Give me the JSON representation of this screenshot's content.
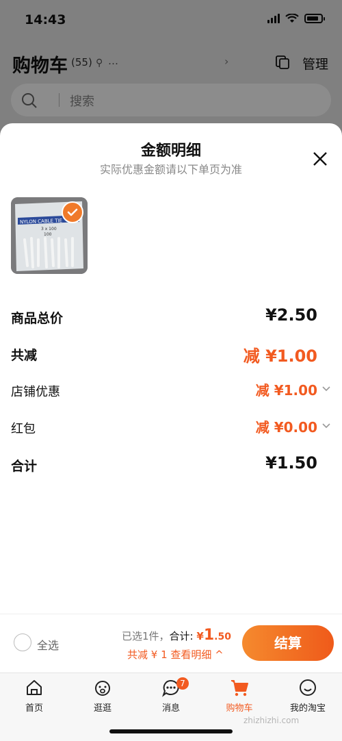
{
  "status_bar": {
    "time": "14:43"
  },
  "header": {
    "title": "购物车",
    "count": "(55)",
    "location": "…",
    "manage_label": "管理"
  },
  "search": {
    "placeholder": "搜索"
  },
  "sheet": {
    "title": "金额明细",
    "subtitle": "实际优惠金额请以下单页为准",
    "product_image_text": [
      "NYLON CABLE TIE",
      "3 x 100",
      "100"
    ],
    "rows": [
      {
        "label": "商品总价",
        "value": "¥2.50"
      },
      {
        "label": "共减",
        "value": "减 ¥1.00"
      },
      {
        "label": "店铺优惠",
        "value": "减 ¥1.00"
      },
      {
        "label": "红包",
        "value": "减 ¥0.00"
      },
      {
        "label": "合计",
        "value": "¥1.50"
      }
    ]
  },
  "bottom_bar": {
    "select_all": "全选",
    "selected_text": "已选1件，",
    "total_label": "合计:",
    "total_yen": "¥",
    "total_int": "1",
    "total_cents": ".50",
    "discount_text": "共减 ¥ 1  查看明细 ^",
    "checkout_label": "结算"
  },
  "tabs": [
    {
      "label": "首页",
      "icon": "home-icon"
    },
    {
      "label": "逛逛",
      "icon": "discover-icon"
    },
    {
      "label": "消息",
      "icon": "message-icon",
      "badge": "7"
    },
    {
      "label": "购物车",
      "icon": "cart-icon",
      "active": true
    },
    {
      "label": "我的淘宝",
      "icon": "profile-icon"
    }
  ],
  "watermark": "zhizhizhi.com",
  "colors": {
    "accent": "#f25a20",
    "checkout_start": "#f58a2e",
    "checkout_end": "#ef5a1a"
  }
}
